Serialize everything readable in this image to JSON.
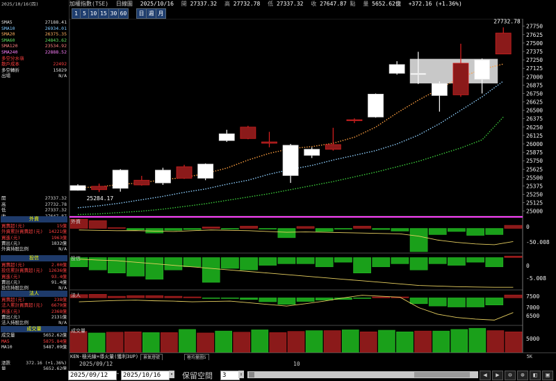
{
  "header": {
    "date": "2025/10/16(四)",
    "index_name": "加權指數(TSE)",
    "period": "日線圖",
    "bar_date": "2025/10/16",
    "open_label": "開",
    "open": "27337.32",
    "high_label": "高",
    "high": "27732.78",
    "low_label": "低",
    "low": "27337.32",
    "close_label": "收",
    "close": "27647.87",
    "pts_label": "點",
    "vol_label": "量",
    "vol": "5652.62億",
    "change": "+372.16 (+1.36%)"
  },
  "toolbar": {
    "buttons": [
      "1",
      "5",
      "10",
      "15",
      "30",
      "60",
      "日",
      "週",
      "月"
    ]
  },
  "left_panel": {
    "ma_rows": [
      {
        "label": "SMA5",
        "value": "27188.41",
        "color": "#e0e0e0"
      },
      {
        "label": "SMA10",
        "value": "26934.01",
        "color": "#7ec8ff"
      },
      {
        "label": "SMA20",
        "value": "26375.35",
        "color": "#ffb060"
      },
      {
        "label": "SMA60",
        "value": "24843.62",
        "color": "#60e060"
      },
      {
        "label": "SMA120",
        "value": "23534.92",
        "color": "#ff8080"
      },
      {
        "label": "SMA240",
        "value": "22888.52",
        "color": "#ff80ff"
      },
      {
        "label": "多空分水嶺",
        "value": "",
        "color": "#ff4040"
      },
      {
        "label": "散戶成本",
        "value": "22492",
        "color": "#ff4040"
      },
      {
        "label": "多空轉折",
        "value": "15829",
        "color": "#e0e0e0"
      },
      {
        "label": "出場",
        "value": "N/A",
        "color": "#e0e0e0"
      }
    ],
    "ohlc_rows": [
      {
        "label": "開",
        "value": "27337.32"
      },
      {
        "label": "高",
        "value": "27732.78"
      },
      {
        "label": "低",
        "value": "27337.32"
      },
      {
        "label": "收",
        "value": "27647.87"
      }
    ],
    "foreign_title": "外資",
    "foreign_rows": [
      {
        "label": "買賣超(元)",
        "value": "15億",
        "color": "#ff4040"
      },
      {
        "label": "外資累計買賣超(元)",
        "value": "14221億",
        "color": "#ff4040"
      },
      {
        "label": "買進(元)",
        "value": "1963億",
        "color": "#ff4040"
      },
      {
        "label": "賣出(元)",
        "value": "1832億",
        "color": "#e0e0e0"
      },
      {
        "label": "外資持股比例",
        "value": "N/A",
        "color": "#e0e0e0"
      }
    ],
    "trust_title": "投信",
    "trust_rows": [
      {
        "label": "買賣超(元)",
        "value": "2.00億",
        "color": "#ff4040"
      },
      {
        "label": "投信累計買賣超(元)",
        "value": "12636億",
        "color": "#ff4040"
      },
      {
        "label": "買進(元)",
        "value": "93.4億",
        "color": "#ff4040"
      },
      {
        "label": "賣出(元)",
        "value": "91.4億",
        "color": "#e0e0e0"
      },
      {
        "label": "投信持股比例",
        "value": "N/A",
        "color": "#e0e0e0"
      }
    ],
    "inst_title": "法人",
    "inst_rows": [
      {
        "label": "買賣超(元)",
        "value": "238億",
        "color": "#ff4040"
      },
      {
        "label": "法人累計買賣超(元)",
        "value": "6679億",
        "color": "#ff4040"
      },
      {
        "label": "買進(元)",
        "value": "2368億",
        "color": "#ff4040"
      },
      {
        "label": "賣出(元)",
        "value": "2131億",
        "color": "#e0e0e0"
      },
      {
        "label": "法人持股比例",
        "value": "N/A",
        "color": "#e0e0e0"
      }
    ],
    "vol_title": "成交量",
    "vol_rows": [
      {
        "label": "成交量",
        "value": "5652.62億",
        "color": "#e0e0e0"
      },
      {
        "label": "MA5",
        "value": "5875.84億",
        "color": "#ff4040"
      },
      {
        "label": "MA10",
        "value": "5487.09億",
        "color": "#e0e0e0"
      }
    ],
    "bottom_rows": [
      {
        "label": "漲跌",
        "value": "372.16 (+1.36%)"
      },
      {
        "label": "量",
        "value": "5652.62億"
      }
    ]
  },
  "status_bar": {
    "label": "KEN-極光線+導火量(獲利3UP)",
    "tab1": "景氣燈號",
    "tab2": "極均量圖5",
    "date_left": "2025/09/12",
    "tick_10": "10",
    "corner": "5K"
  },
  "bottom_bar": {
    "from_date": "2025/09/12",
    "to_date": "2025/10/16",
    "space_label": "保留空間",
    "space_value": "3"
  },
  "chart_data": {
    "type": "candlestick",
    "yticks": [
      25000,
      25125,
      25250,
      25375,
      25500,
      25625,
      25750,
      25875,
      26000,
      26125,
      26250,
      26375,
      26500,
      26625,
      26750,
      26875,
      27000,
      27125,
      27250,
      27375,
      27500,
      27625,
      27750
    ],
    "ylim": [
      24935,
      27830
    ],
    "high_annotation": "27732.78",
    "low_annotation": "25284.17",
    "candles": [
      {
        "o": 25380,
        "h": 25400,
        "l": 25305,
        "c": 25310
      },
      {
        "o": 25320,
        "h": 25410,
        "l": 25284,
        "c": 25370
      },
      {
        "o": 25610,
        "h": 25625,
        "l": 25290,
        "c": 25340
      },
      {
        "o": 25390,
        "h": 25525,
        "l": 25380,
        "c": 25460
      },
      {
        "o": 25610,
        "h": 25645,
        "l": 25390,
        "c": 25420
      },
      {
        "o": 25490,
        "h": 25690,
        "l": 25480,
        "c": 25660
      },
      {
        "o": 25700,
        "h": 25710,
        "l": 25460,
        "c": 25490
      },
      {
        "o": 26150,
        "h": 26210,
        "l": 26030,
        "c": 26050
      },
      {
        "o": 26080,
        "h": 26270,
        "l": 26070,
        "c": 26250
      },
      {
        "o": 26010,
        "h": 26180,
        "l": 25950,
        "c": 26030
      },
      {
        "o": 25980,
        "h": 26000,
        "l": 25420,
        "c": 25530
      },
      {
        "o": 25920,
        "h": 25950,
        "l": 25790,
        "c": 25830
      },
      {
        "o": 25920,
        "h": 26240,
        "l": 25900,
        "c": 25990
      },
      {
        "o": 26360,
        "h": 26380,
        "l": 26310,
        "c": 26360
      },
      {
        "o": 26740,
        "h": 26750,
        "l": 26390,
        "c": 26400
      },
      {
        "o": 27180,
        "h": 27230,
        "l": 27030,
        "c": 27050
      },
      {
        "o": 27050,
        "h": 27370,
        "l": 26890,
        "c": 27030
      },
      {
        "o": 26900,
        "h": 26930,
        "l": 26480,
        "c": 26720
      },
      {
        "o": 26730,
        "h": 27490,
        "l": 26700,
        "c": 27200
      },
      {
        "o": 27250,
        "h": 27270,
        "l": 26750,
        "c": 26960
      },
      {
        "o": 27337,
        "h": 27733,
        "l": 27337,
        "c": 27648
      }
    ],
    "candle_colors": {
      "up": "#8b1a1a",
      "up_border": "#d02020",
      "down": "#ffffff",
      "down_border": "#dddddd"
    },
    "highlight_box": {
      "from_index": 16,
      "to_index": 20,
      "high": 27265,
      "low": 26900
    },
    "sma5": [
      25350,
      25360,
      25400,
      25420,
      25470,
      25500,
      25560,
      25640,
      25760,
      25860,
      25930,
      25960,
      26010,
      26100,
      26250,
      26460,
      26650,
      26820,
      26990,
      27110,
      27188
    ],
    "sma10": [
      25050,
      25080,
      25120,
      25170,
      25220,
      25280,
      25330,
      25400,
      25460,
      25550,
      25620,
      25680,
      25760,
      25830,
      25900,
      26000,
      26130,
      26300,
      26500,
      26700,
      26934
    ],
    "sma60": [
      24950,
      24960,
      24980,
      25000,
      25030,
      25070,
      25110,
      25160,
      25210,
      25260,
      25320,
      25380,
      25440,
      25510,
      25580,
      25660,
      25740,
      25840,
      25940,
      26060,
      26400
    ],
    "foreign": {
      "ticks": [
        "0",
        "-50.008"
      ],
      "bars": [
        120,
        100,
        10,
        -20,
        -60,
        -25,
        -15,
        20,
        -10,
        30,
        -10,
        -120,
        25,
        -40,
        -10,
        30,
        -15,
        -35,
        -300,
        -80,
        -40,
        -90,
        -80,
        40
      ],
      "line": [
        -20,
        -25,
        -30,
        -28,
        -35,
        -40,
        -30,
        -20,
        -25,
        -30,
        -40,
        -50,
        -45,
        -50,
        -55,
        -60,
        -65,
        -70,
        -100,
        -150,
        -180,
        -200,
        -210,
        -170
      ]
    },
    "trust": {
      "ticks": [
        "0",
        "-5.008"
      ],
      "bars": [
        -30,
        -40,
        -50,
        -60,
        -70,
        -40,
        -30,
        -80,
        -35,
        -40,
        -25,
        -20,
        -20,
        -30,
        -15,
        -50,
        -30,
        -20,
        -40,
        -20,
        -25,
        -15,
        -30,
        5
      ],
      "line": [
        -5,
        -8,
        -10,
        -15,
        -20,
        -25,
        -30,
        -35,
        -40,
        -45,
        -50,
        -55,
        -60,
        -65,
        -70,
        -75,
        -80,
        -85,
        -90,
        -92,
        -94,
        -95,
        -96,
        -96
      ]
    },
    "inst": {
      "ticks": [
        "7500",
        "7000",
        "6500"
      ],
      "bars": [
        7500,
        7510,
        7450,
        7470,
        7470,
        7450,
        7430,
        7390,
        7380,
        7350,
        7280,
        7200,
        7290,
        7330,
        7350,
        7390,
        7430,
        7430,
        7220,
        7150,
        7120,
        7120,
        7180,
        7490
      ],
      "line": [
        7280,
        7300,
        7320,
        7330,
        7310,
        7300,
        7280,
        7290,
        7300,
        7250,
        7200,
        7150,
        7220,
        7300,
        7400,
        7480,
        7450,
        7420,
        7100,
        6900,
        6800,
        6750,
        6720,
        6950
      ]
    },
    "volume": {
      "ticks": [
        "5000"
      ],
      "bars": [
        5200,
        4800,
        5000,
        5100,
        4900,
        4900,
        5700,
        4800,
        5300,
        5000,
        5600,
        4900,
        5200,
        5400,
        5400,
        5600,
        5100,
        5500,
        5100,
        5300,
        5300,
        5700,
        6000,
        5400,
        5100
      ],
      "up": [
        true,
        false,
        true,
        true,
        false,
        true,
        false,
        true,
        false,
        true,
        false,
        true,
        true,
        false,
        true,
        false,
        true,
        false,
        false,
        true,
        false,
        false,
        false,
        true,
        true
      ]
    }
  }
}
